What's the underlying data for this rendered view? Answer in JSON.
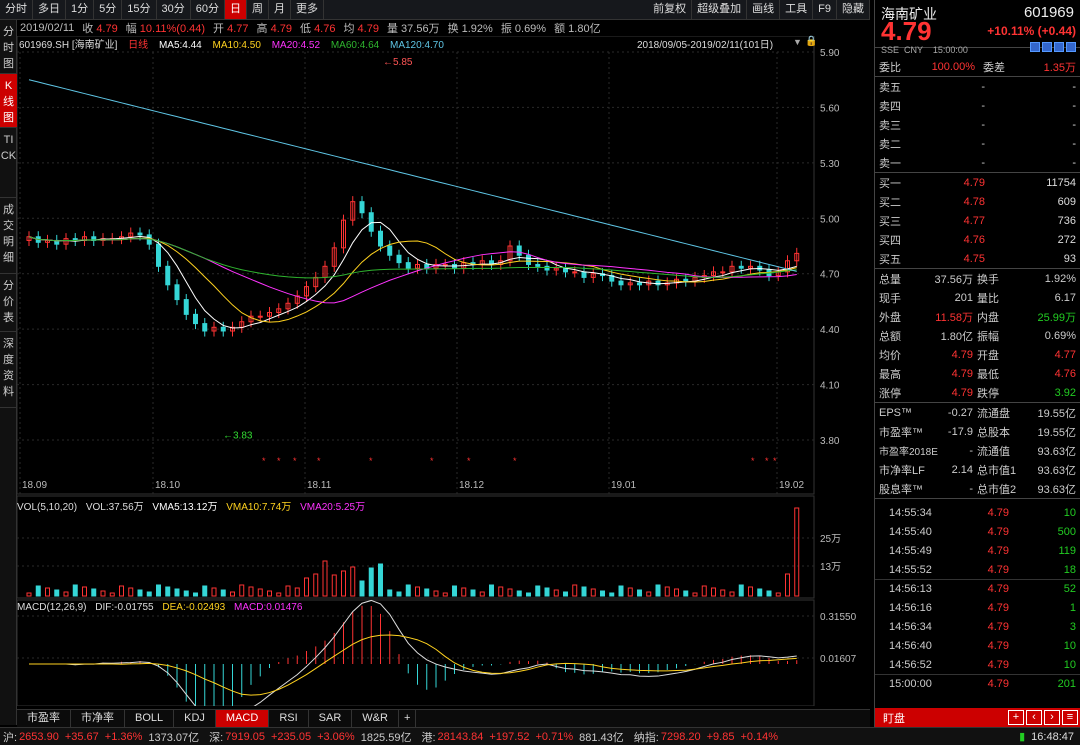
{
  "toolbar": {
    "left": [
      "分时",
      "多日",
      "1分",
      "5分",
      "15分",
      "30分",
      "60分",
      "日",
      "周",
      "月",
      "更多"
    ],
    "right": [
      "前复权",
      "超级叠加",
      "画线",
      "工具",
      "F9",
      "隐藏"
    ],
    "active": "日"
  },
  "infobar": {
    "date": "2019/02/11",
    "close_label": "收",
    "close": "4.79",
    "chg_label": "幅",
    "chg": "10.11%(0.44)",
    "open_label": "开",
    "open": "4.77",
    "high_label": "高",
    "high": "4.79",
    "low_label": "低",
    "low": "4.76",
    "avg_label": "均",
    "avg": "4.79",
    "vol_label": "量",
    "vol": "37.56万",
    "turn_label": "换",
    "turn": "1.92%",
    "amp_label": "振",
    "amp": "0.69%",
    "amt_label": "额",
    "amt": "1.80亿"
  },
  "left_tabs": [
    "分时图",
    "K线图",
    "TICK",
    "成交明细",
    "分价表",
    "深度资料"
  ],
  "chart_legend": {
    "code": "601969.SH [海南矿业]",
    "period": "日线",
    "ma5": "MA5:4.44",
    "ma10": "MA10:4.50",
    "ma20": "MA20:4.52",
    "ma60": "MA60:4.64",
    "ma120": "MA120:4.70",
    "range": "2018/09/05-2019/02/11(101日)"
  },
  "vol_legend": {
    "title": "VOL(5,10,20)",
    "vol": "VOL:37.56万",
    "ma5": "VMA5:13.12万",
    "ma10": "VMA10:7.74万",
    "ma20": "VMA20:5.25万"
  },
  "macd_legend": {
    "title": "MACD(12,26,9)",
    "dif": "DIF:-0.01755",
    "dea": "DEA:-0.02493",
    "macd": "MACD:0.01476"
  },
  "bottom_tabs": [
    "市盈率",
    "市净率",
    "BOLL",
    "KDJ",
    "MACD",
    "RSI",
    "SAR",
    "W&R",
    "+"
  ],
  "active_bottom": "MACD",
  "chart_data": {
    "type": "candlestick",
    "price_axis": [
      "5.90",
      "5.60",
      "5.30",
      "5.00",
      "4.70",
      "4.40",
      "4.10",
      "3.80"
    ],
    "date_axis": [
      "18.09",
      "18.10",
      "18.11",
      "18.12",
      "19.01",
      "19.02"
    ],
    "annot_high": "5.85",
    "annot_low": "3.83",
    "vol_axis": [
      "25万",
      "13万"
    ],
    "macd_axis": [
      "0.31550",
      "0.01607"
    ],
    "colors": {
      "up": "#ff3333",
      "down": "#35d6d6",
      "ma5": "#ffffff",
      "ma10": "#ffd21f",
      "ma20": "#ff33ff",
      "ma60": "#2fb52f",
      "ma120": "#5fc6e6"
    }
  },
  "quote": {
    "name": "海南矿业",
    "code": "601969",
    "price": "4.79",
    "change": "+10.11% (+0.44)",
    "market": "SSE  CNY    15:00:00",
    "weibi_label": "委比",
    "weibi": "100.00%",
    "weicha_label": "委差",
    "weicha": "1.35万",
    "asks": [
      {
        "label": "卖五",
        "price": "-",
        "vol": "-"
      },
      {
        "label": "卖四",
        "price": "-",
        "vol": "-"
      },
      {
        "label": "卖三",
        "price": "-",
        "vol": "-"
      },
      {
        "label": "卖二",
        "price": "-",
        "vol": "-"
      },
      {
        "label": "卖一",
        "price": "-",
        "vol": "-"
      }
    ],
    "bids": [
      {
        "label": "买一",
        "price": "4.79",
        "vol": "11754"
      },
      {
        "label": "买二",
        "price": "4.78",
        "vol": "609"
      },
      {
        "label": "买三",
        "price": "4.77",
        "vol": "736"
      },
      {
        "label": "买四",
        "price": "4.76",
        "vol": "272"
      },
      {
        "label": "买五",
        "price": "4.75",
        "vol": "93"
      }
    ],
    "stats": [
      {
        "l1": "总量",
        "v1": "37.56万",
        "l2": "换手",
        "v2": "1.92%"
      },
      {
        "l1": "现手",
        "v1": "201",
        "l2": "量比",
        "v2": "6.17"
      },
      {
        "l1": "外盘",
        "v1": "11.58万",
        "l2": "内盘",
        "v2": "25.99万"
      },
      {
        "l1": "总额",
        "v1": "1.80亿",
        "l2": "振幅",
        "v2": "0.69%"
      },
      {
        "l1": "均价",
        "v1": "4.79",
        "l2": "开盘",
        "v2": "4.77"
      },
      {
        "l1": "最高",
        "v1": "4.79",
        "l2": "最低",
        "v2": "4.76"
      },
      {
        "l1": "涨停",
        "v1": "4.79",
        "l2": "跌停",
        "v2": "3.92"
      }
    ],
    "fin": [
      {
        "l1": "EPS™",
        "v1": "-0.27",
        "l2": "流通盘",
        "v2": "19.55亿"
      },
      {
        "l1": "市盈率™",
        "v1": "-17.9",
        "l2": "总股本",
        "v2": "19.55亿"
      },
      {
        "l1": "市盈率2018E",
        "v1": "-",
        "l2": "流通值",
        "v2": "93.63亿"
      },
      {
        "l1": "市净率LF",
        "v1": "2.14",
        "l2": "总市值1",
        "v2": "93.63亿"
      },
      {
        "l1": "股息率™",
        "v1": "-",
        "l2": "总市值2",
        "v2": "93.63亿"
      }
    ],
    "ticks": [
      {
        "t": "14:55:34",
        "p": "4.79",
        "v": "10"
      },
      {
        "t": "14:55:40",
        "p": "4.79",
        "v": "500"
      },
      {
        "t": "14:55:49",
        "p": "4.79",
        "v": "119"
      },
      {
        "t": "14:55:52",
        "p": "4.79",
        "v": "18"
      },
      {
        "t": "14:56:13",
        "p": "4.79",
        "v": "52"
      },
      {
        "t": "14:56:16",
        "p": "4.79",
        "v": "1"
      },
      {
        "t": "14:56:34",
        "p": "4.79",
        "v": "3"
      },
      {
        "t": "14:56:40",
        "p": "4.79",
        "v": "10"
      },
      {
        "t": "14:56:52",
        "p": "4.79",
        "v": "10"
      },
      {
        "t": "15:00:00",
        "p": "4.79",
        "v": "201"
      }
    ],
    "footer_label": "盯盘"
  },
  "status": {
    "sh_label": "沪:",
    "sh": "2653.90",
    "sh_chg": "+35.67",
    "sh_pct": "+1.36%",
    "sh_amt": "1373.07亿",
    "sz_label": "深:",
    "sz": "7919.05",
    "sz_chg": "+235.05",
    "sz_pct": "+3.06%",
    "sz_amt": "1825.59亿",
    "hk_label": "港:",
    "hk": "28143.84",
    "hk_chg": "+197.52",
    "hk_pct": "+0.71%",
    "hk_amt": "881.43亿",
    "nd_label": "纳指:",
    "nd": "7298.20",
    "nd_chg": "+9.85",
    "nd_pct": "+0.14%",
    "time": "16:48:47"
  }
}
